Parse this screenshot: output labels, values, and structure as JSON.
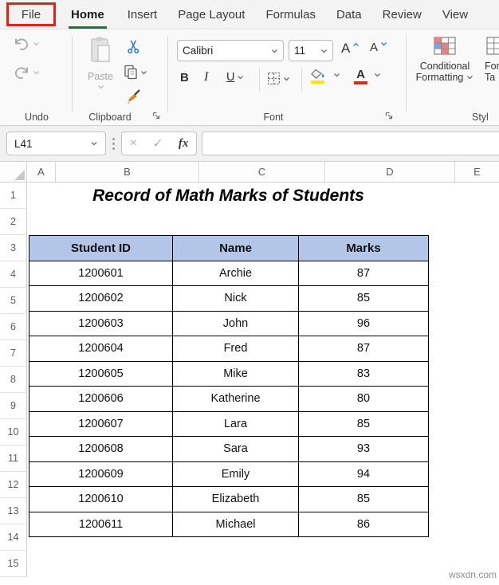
{
  "tabs": {
    "file": "File",
    "home": "Home",
    "insert": "Insert",
    "page_layout": "Page Layout",
    "formulas": "Formulas",
    "data": "Data",
    "review": "Review",
    "view": "View"
  },
  "ribbon": {
    "undo": {
      "label": "Undo"
    },
    "clipboard": {
      "label": "Clipboard",
      "paste": "Paste"
    },
    "font": {
      "label": "Font",
      "font_name": "Calibri",
      "font_size": "11",
      "bold": "B",
      "italic": "I",
      "underline": "U",
      "grow_letter": "A",
      "shrink_letter": "A"
    },
    "styles": {
      "label": "Styl",
      "conditional_line1": "Conditional",
      "conditional_line2": "Formatting",
      "format_table_line1": "For",
      "format_table_line2": "Ta"
    }
  },
  "formula_bar": {
    "name_box": "L41",
    "cancel": "×",
    "enter": "✓",
    "fx": "fx"
  },
  "sheet": {
    "column_headers": [
      "A",
      "B",
      "C",
      "D",
      "E"
    ],
    "row_headers": [
      "1",
      "2",
      "3",
      "4",
      "5",
      "6",
      "7",
      "8",
      "9",
      "10",
      "11",
      "12",
      "13",
      "14",
      "15"
    ]
  },
  "content": {
    "title": "Record of Math Marks of Students",
    "table": {
      "headers": [
        "Student ID",
        "Name",
        "Marks"
      ],
      "rows": [
        [
          "1200601",
          "Archie",
          "87"
        ],
        [
          "1200602",
          "Nick",
          "85"
        ],
        [
          "1200603",
          "John",
          "96"
        ],
        [
          "1200604",
          "Fred",
          "87"
        ],
        [
          "1200605",
          "Mike",
          "83"
        ],
        [
          "1200606",
          "Katherine",
          "80"
        ],
        [
          "1200607",
          "Lara",
          "85"
        ],
        [
          "1200608",
          "Sara",
          "93"
        ],
        [
          "1200609",
          "Emily",
          "94"
        ],
        [
          "1200610",
          "Elizabeth",
          "85"
        ],
        [
          "1200611",
          "Michael",
          "86"
        ]
      ]
    }
  },
  "watermark": "wsxdn.com",
  "colors": {
    "table_header_fill": "#b4c6e7",
    "home_underline_green": "#1e7145",
    "annotation_red": "#e42313",
    "highlight_yellow": "#ffe500",
    "font_color_red": "#d92a1c"
  }
}
